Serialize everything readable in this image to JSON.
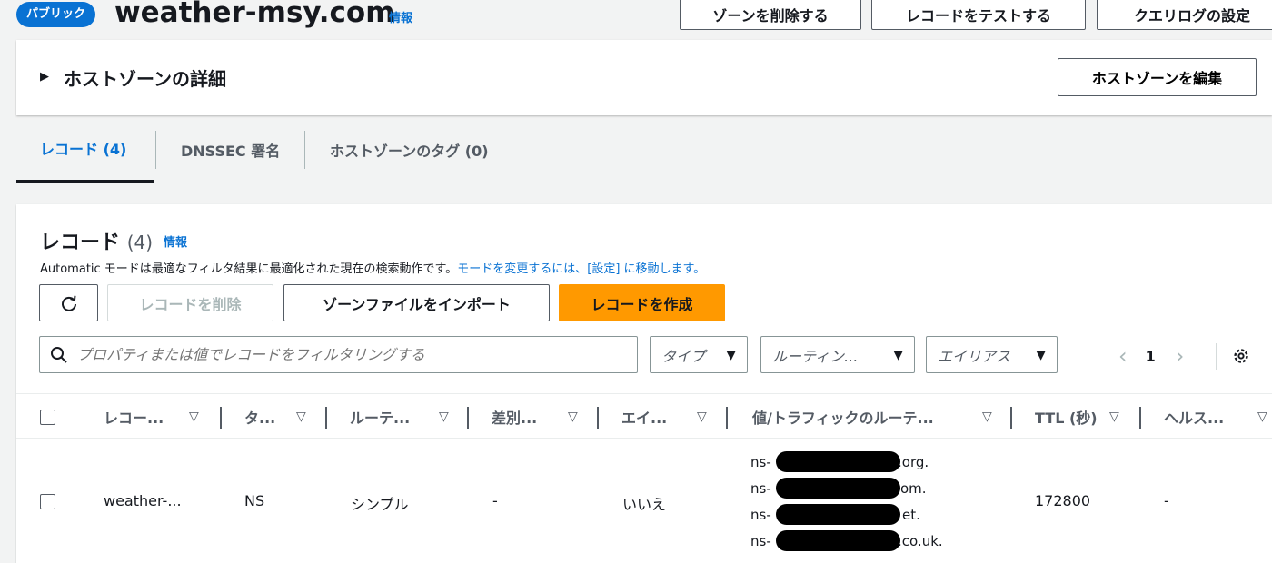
{
  "header": {
    "badge": "パブリック",
    "title": "weather-msy.com",
    "info": "情報",
    "buttons": [
      "ゾーンを削除する",
      "レコードをテストする",
      "クエリログの設定"
    ]
  },
  "details": {
    "title": "ホストゾーンの詳細",
    "edit_button": "ホストゾーンを編集"
  },
  "tabs": [
    "レコード (4)",
    "DNSSEC 署名",
    "ホストゾーンのタグ (0)"
  ],
  "records": {
    "title": "レコード",
    "count": "(4)",
    "info": "情報",
    "description": "Automatic モードは最適なフィルタ結果に最適化された現在の検索動作です。",
    "description_link": "モードを変更するには、[設定] に移動します。",
    "actions": {
      "delete": "レコードを削除",
      "import": "ゾーンファイルをインポート",
      "create": "レコードを作成"
    },
    "search_placeholder": "プロパティまたは値でレコードをフィルタリングする",
    "filters": {
      "type": "タイプ",
      "routing": "ルーティン...",
      "alias": "エイリアス"
    },
    "page": "1",
    "columns": [
      "レコー...",
      "タ...",
      "ルーテ...",
      "差別...",
      "エイ...",
      "値/トラフィックのルーテ...",
      "TTL (秒)",
      "ヘルス..."
    ],
    "rows": [
      {
        "name": "weather-...",
        "type": "NS",
        "routing": "シンプル",
        "differentiator": "-",
        "alias": "いいえ",
        "values": [
          "ns-",
          "ns-",
          "ns-",
          "ns-"
        ],
        "value_suffixes": [
          ".org.",
          "om.",
          "et.",
          ".co.uk."
        ],
        "ttl": "172800",
        "health": "-"
      }
    ]
  },
  "colors": {
    "primary": "#0972d3",
    "accent": "#ff9900"
  }
}
